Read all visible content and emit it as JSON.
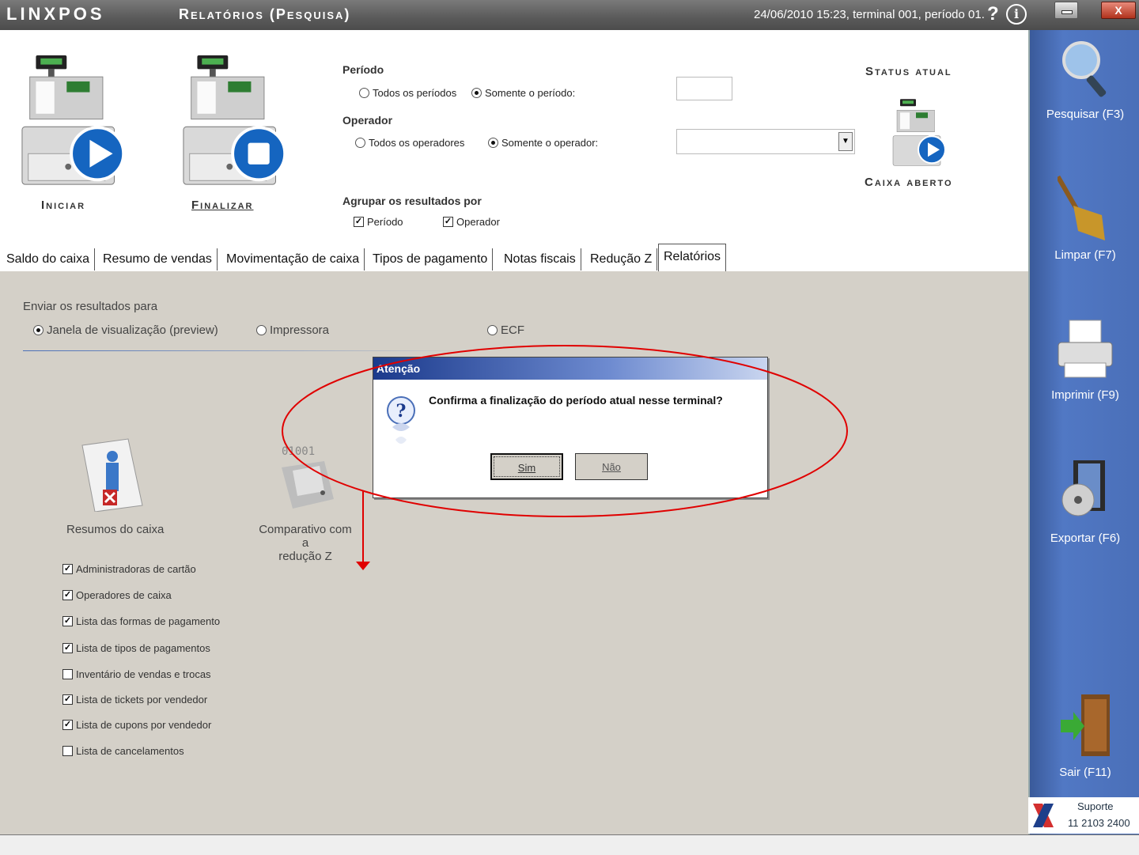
{
  "app": {
    "logo": "LINXPOS",
    "title": "Relatórios (Pesquisa)",
    "status": "24/06/2010 15:23, terminal 001, período 01.",
    "help": "?",
    "info": "i",
    "close": "X"
  },
  "top": {
    "start_label": "Iniciar",
    "finish_label": "Finalizar",
    "periodo_title": "Período",
    "periodo_all": "Todos os períodos",
    "periodo_only": "Somente o período:",
    "operador_title": "Operador",
    "operador_all": "Todos os operadores",
    "operador_only": "Somente o operador:",
    "group_title": "Agrupar os resultados por",
    "group_periodo": "Período",
    "group_operador": "Operador",
    "status_title": "Status atual",
    "status_value": "Caixa aberto"
  },
  "tabs": [
    {
      "label": "Saldo do caixa"
    },
    {
      "label": "Resumo de vendas"
    },
    {
      "label": "Movimentação de caixa"
    },
    {
      "label": "Tipos de pagamento"
    },
    {
      "label": "Notas fiscais"
    },
    {
      "label": "Redução Z"
    },
    {
      "label": "Relatórios"
    }
  ],
  "content": {
    "send_title": "Enviar os resultados para",
    "send_preview": "Janela de visualização (preview)",
    "send_printer": "Impressora",
    "send_ecf": "ECF",
    "report1_label": "Resumos do caixa",
    "report2_label_line1": "Comparativo com a",
    "report2_label_line2": "redução Z",
    "report2_bits": "01001",
    "checklist": [
      {
        "label": "Administradoras de cartão",
        "checked": true
      },
      {
        "label": "Operadores de caixa",
        "checked": true
      },
      {
        "label": "Lista das formas de pagamento",
        "checked": true
      },
      {
        "label": "Lista de tipos de pagamentos",
        "checked": true
      },
      {
        "label": "Inventário de vendas e trocas",
        "checked": false
      },
      {
        "label": "Lista de tickets por vendedor",
        "checked": true
      },
      {
        "label": "Lista de cupons por vendedor",
        "checked": true
      },
      {
        "label": "Lista de cancelamentos",
        "checked": false
      }
    ]
  },
  "sidebar": [
    {
      "label": "Pesquisar (F3)"
    },
    {
      "label": "Limpar (F7)"
    },
    {
      "label": "Imprimir (F9)"
    },
    {
      "label": "Exportar (F6)"
    },
    {
      "label": "Sair (F11)"
    }
  ],
  "support": {
    "title": "Suporte",
    "phone": "11 2103 2400"
  },
  "dialog": {
    "title": "Atenção",
    "message": "Confirma a finalização do período atual nesse terminal?",
    "yes": "Sim",
    "no": "Não"
  },
  "colors": {
    "sidebar": "#4a6fb8",
    "content_bg": "#d4d0c8",
    "annotation": "#e00000"
  }
}
